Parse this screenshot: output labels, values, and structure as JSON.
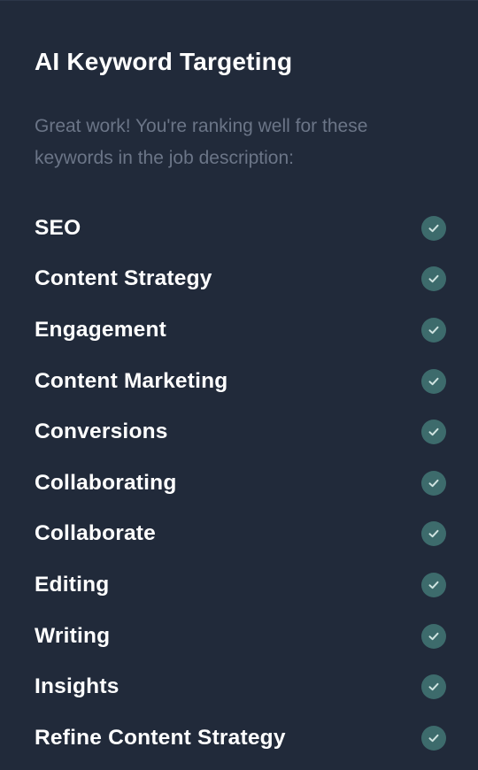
{
  "panel": {
    "title": "AI Keyword Targeting",
    "subtitle": "Great work! You're ranking well for these keywords in the job description:"
  },
  "keywords": [
    {
      "label": "SEO",
      "icon": "check-circle-icon"
    },
    {
      "label": "Content Strategy",
      "icon": "check-circle-icon"
    },
    {
      "label": "Engagement",
      "icon": "check-circle-icon"
    },
    {
      "label": "Content Marketing",
      "icon": "check-circle-icon"
    },
    {
      "label": "Conversions",
      "icon": "check-circle-icon"
    },
    {
      "label": "Collaborating",
      "icon": "check-circle-icon"
    },
    {
      "label": "Collaborate",
      "icon": "check-circle-icon"
    },
    {
      "label": "Editing",
      "icon": "check-circle-icon"
    },
    {
      "label": "Writing",
      "icon": "check-circle-icon"
    },
    {
      "label": "Insights",
      "icon": "check-circle-icon"
    },
    {
      "label": "Refine Content Strategy",
      "icon": "check-circle-icon"
    }
  ],
  "colors": {
    "background": "#212a3a",
    "title": "#ffffff",
    "subtitle": "#6b7587",
    "check_bg": "#3d6b6c",
    "check_mark": "#cfe3e0"
  }
}
